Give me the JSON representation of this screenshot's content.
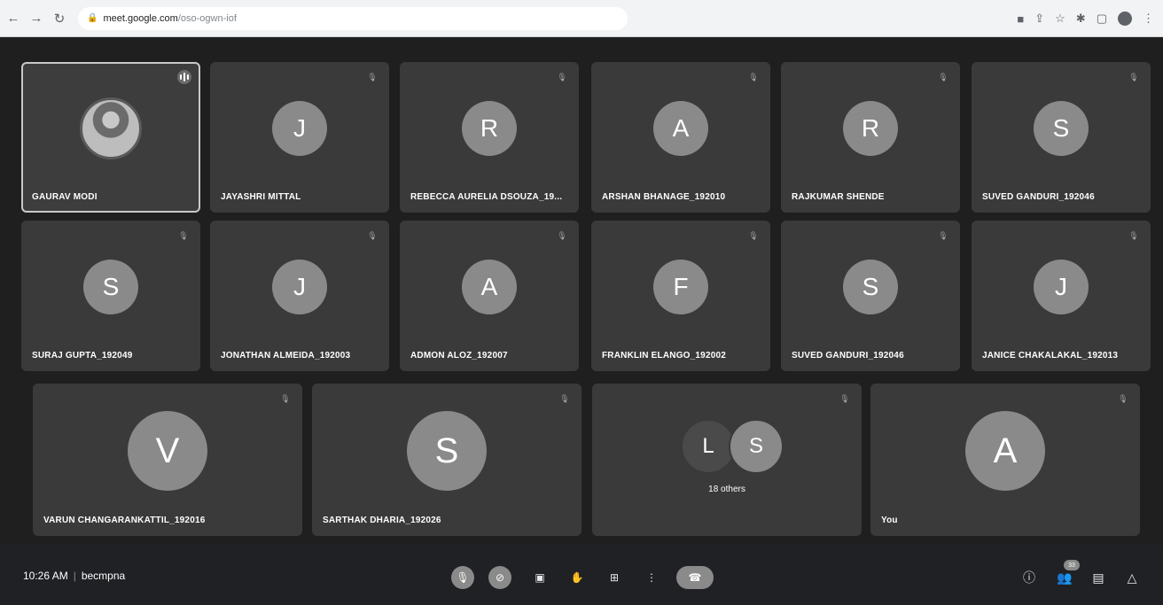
{
  "browser": {
    "url_host": "meet.google.com",
    "url_path": "/oso-ogwn-iof"
  },
  "tiles_row1": [
    {
      "name": "GAURAV MODI",
      "initial": "",
      "photo": true,
      "speaking": true
    },
    {
      "name": "JAYASHRI MITTAL",
      "initial": "J"
    },
    {
      "name": "REBECCA AURELIA DSOUZA_19...",
      "initial": "R"
    },
    {
      "name": "ARSHAN BHANAGE_192010",
      "initial": "A"
    },
    {
      "name": "RAJKUMAR SHENDE",
      "initial": "R"
    },
    {
      "name": "SUVED GANDURI_192046",
      "initial": "S"
    }
  ],
  "tiles_row2": [
    {
      "name": "SURAJ GUPTA_192049",
      "initial": "S"
    },
    {
      "name": "JONATHAN ALMEIDA_192003",
      "initial": "J"
    },
    {
      "name": "ADMON ALOZ_192007",
      "initial": "A"
    },
    {
      "name": "FRANKLIN ELANGO_192002",
      "initial": "F"
    },
    {
      "name": "SUVED GANDURI_192046",
      "initial": "S"
    },
    {
      "name": "JANICE CHAKALAKAL_192013",
      "initial": "J"
    }
  ],
  "tiles_row3": [
    {
      "name": "VARUN CHANGARANKATTIL_192016",
      "initial": "V"
    },
    {
      "name": "SARTHAK DHARIA_192026",
      "initial": "S"
    },
    {
      "name": "",
      "initials": [
        "L",
        "S"
      ],
      "caption": "18 others"
    },
    {
      "name": "You",
      "initial": "A"
    }
  ],
  "bottom": {
    "time": "10:26 AM",
    "meeting_code": "becmpna",
    "participants_count": "33"
  },
  "icons": {
    "mic": "mic-off-icon",
    "camera": "camera-off-icon",
    "captions": "captions-icon",
    "hand": "raise-hand-icon",
    "present": "present-screen-icon",
    "more": "more-options-icon",
    "end": "end-call-icon",
    "info": "info-icon",
    "people": "people-icon",
    "chat": "chat-icon",
    "activities": "activities-icon"
  },
  "colors": {
    "stage_bg": "#1f1f1f",
    "tile_bg": "#3a3a3a",
    "avatar_bg": "#8a8a8a"
  }
}
